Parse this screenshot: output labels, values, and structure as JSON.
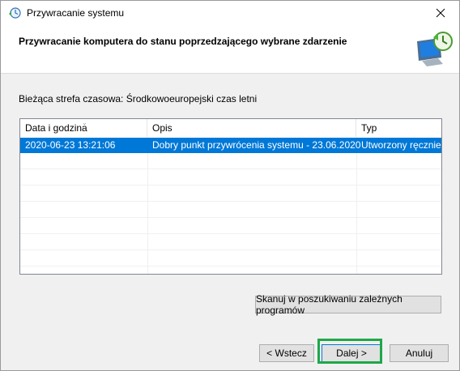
{
  "window": {
    "title": "Przywracanie systemu",
    "close_symbol": "✕",
    "icon": "system-restore-icon"
  },
  "header": {
    "title": "Przywracanie komputera do stanu poprzedzającego wybrane zdarzenie",
    "icon": "monitor-clock-icon"
  },
  "content": {
    "timezone_label": "Bieżąca strefa czasowa: Środkowoeuropejski czas letni",
    "table": {
      "columns": [
        "Data i godzina",
        "Opis",
        "Typ"
      ],
      "rows": [
        {
          "date": "2020-06-23 13:21:06",
          "description": "Dobry punkt przywrócenia systemu - 23.06.2020",
          "type": "Utworzony ręcznie",
          "selected": true
        }
      ]
    },
    "scan_button": "Skanuj w poszukiwaniu zależnych programów"
  },
  "footer": {
    "back_button": "< Wstecz",
    "next_button": "Dalej >",
    "cancel_button": "Anuluj"
  },
  "colors": {
    "selection": "#0078d7",
    "highlight": "#1ea84a"
  }
}
